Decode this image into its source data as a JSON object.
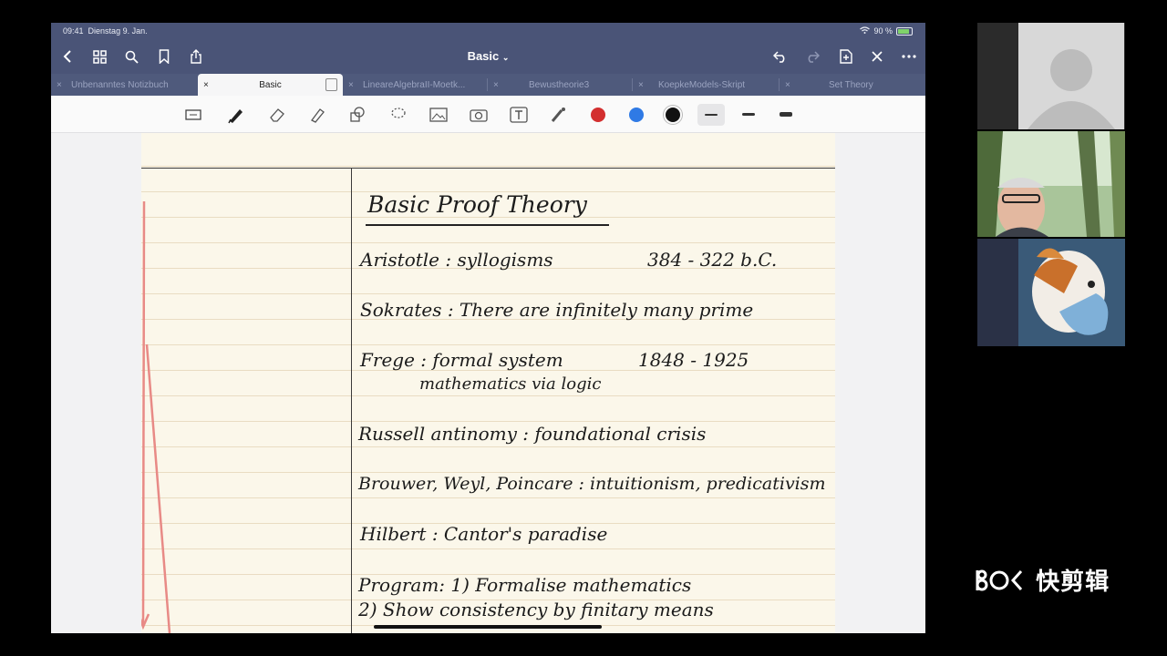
{
  "status": {
    "time": "09:41",
    "date": "Dienstag 9. Jan.",
    "battery": "90 %"
  },
  "nav": {
    "title": "Basic"
  },
  "tabs": [
    {
      "label": "Unbenanntes Notizbuch"
    },
    {
      "label": "Basic"
    },
    {
      "label": "LineareAlgebraII-Moetk..."
    },
    {
      "label": "Bewustheorie3"
    },
    {
      "label": "KoepkeModels-Skript"
    },
    {
      "label": "Set Theory"
    }
  ],
  "colors": {
    "accent_red": "#d32f2f",
    "accent_blue": "#2f7ae5",
    "pen_black": "#111111"
  },
  "notes": {
    "title": "Basic Proof Theory",
    "lines": [
      "Aristotle :   syllogisms",
      "384 - 322  b.C.",
      "Sokrates :  There are infinitely many prime",
      "Frege :    formal system",
      "1848 - 1925",
      "mathematics via logic",
      "Russell antinomy :   foundational crisis",
      "Brouwer, Weyl, Poincare  :  intuitionism, predicativism",
      "Hilbert :  Cantor's paradise",
      "Program:  1)  Formalise mathematics",
      "2)  Show consistency by finitary means"
    ]
  },
  "watermark": "快剪辑"
}
